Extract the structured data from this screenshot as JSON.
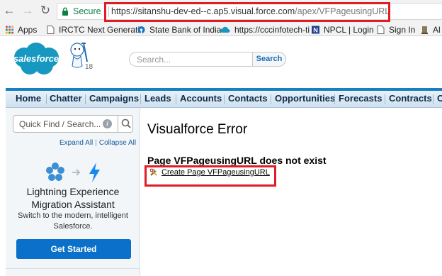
{
  "browser": {
    "back_icon": "arrow-left-icon",
    "forward_icon": "arrow-right-icon",
    "reload_icon": "reload-icon",
    "secure_label": "Secure",
    "url_host": "https://sitanshu-dev-ed--c.ap5.visual.force.com",
    "url_path": "/apex/VFPageusingURL",
    "highlight_color": "#e01c24"
  },
  "bookmarks": [
    {
      "label": "Apps",
      "icon": "apps-grid-icon"
    },
    {
      "label": "IRCTC Next Generatic",
      "icon": "page-icon"
    },
    {
      "label": "State Bank of India",
      "icon": "sbi-icon"
    },
    {
      "label": "https://cccinfotech-ti",
      "icon": "cloud-icon"
    },
    {
      "label": "NPCL | Login",
      "icon": "npcl-icon"
    },
    {
      "label": "Sign In",
      "icon": "page-icon"
    },
    {
      "label": "Al",
      "icon": "emblem-icon"
    }
  ],
  "header": {
    "logo_text": "salesforce",
    "release_badge": "18",
    "search_placeholder": "Search...",
    "search_button": "Search",
    "brand_color": "#1798c1"
  },
  "tabs": [
    "Home",
    "Chatter",
    "Campaigns",
    "Leads",
    "Accounts",
    "Contacts",
    "Opportunities",
    "Forecasts",
    "Contracts",
    "C"
  ],
  "sidebar": {
    "quick_find_placeholder": "Quick Find / Search...",
    "expand_all": "Expand All",
    "collapse_all": "Collapse All",
    "lightning_title_line1": "Lightning Experience",
    "lightning_title_line2": "Migration Assistant",
    "lightning_sub_line1": "Switch to the modern, intelligent",
    "lightning_sub_line2": "Salesforce.",
    "get_started": "Get Started",
    "button_color": "#0a70c9"
  },
  "main": {
    "title": "Visualforce Error",
    "error_heading": "Page VFPageusingURL does not exist",
    "create_link": "Create Page VFPageusingURL"
  }
}
